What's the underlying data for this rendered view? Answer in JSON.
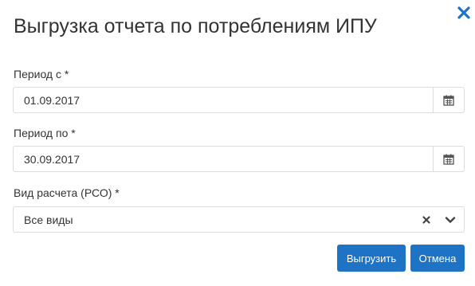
{
  "dialog": {
    "title": "Выгрузка отчета по потреблениям ИПУ",
    "close_icon": "close-icon"
  },
  "fields": {
    "period_from": {
      "label": "Период с *",
      "value": "01.09.2017",
      "icon": "calendar-icon"
    },
    "period_to": {
      "label": "Период по *",
      "value": "30.09.2017",
      "icon": "calendar-icon"
    },
    "calc_type": {
      "label": "Вид расчета (РСО) *",
      "value": "Все виды",
      "clear_icon": "clear-icon",
      "dropdown_icon": "chevron-down-icon"
    }
  },
  "buttons": {
    "export_label": "Выгрузить",
    "cancel_label": "Отмена"
  },
  "colors": {
    "accent": "#1e73c4",
    "text": "#333333",
    "border": "#dcdcdc"
  }
}
